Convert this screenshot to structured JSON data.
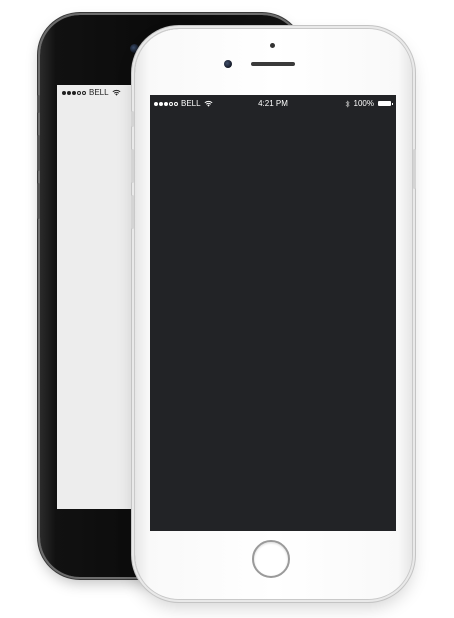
{
  "back_phone": {
    "status_bar": {
      "carrier": "BELL",
      "signal_bars": 5,
      "signal_filled": 3
    },
    "color": "#0a0a0a",
    "screen_color": "#ededed"
  },
  "front_phone": {
    "status_bar": {
      "carrier": "BELL",
      "signal_bars": 5,
      "signal_filled": 3,
      "time": "4:21 PM",
      "battery": "100%"
    },
    "color": "#ffffff",
    "screen_color": "#222326",
    "icons": [
      "wifi-icon",
      "bluetooth-icon",
      "battery-icon",
      "home-button"
    ]
  }
}
